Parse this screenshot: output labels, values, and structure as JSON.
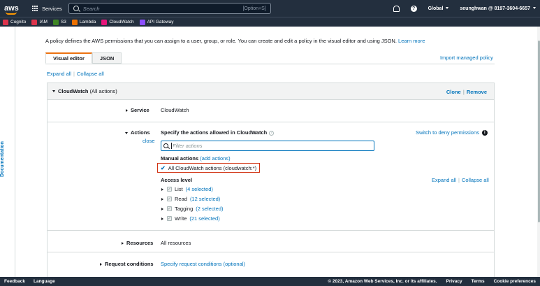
{
  "topnav": {
    "logo": "aws",
    "services_label": "Services",
    "search_placeholder": "Search",
    "search_shortcut": "[Option+S]",
    "region": "Global",
    "account": "seunghwan @ 8197-3604-6657"
  },
  "favorites": [
    {
      "label": "Cognito",
      "color": "#dd344c"
    },
    {
      "label": "IAM",
      "color": "#dd344c"
    },
    {
      "label": "S3",
      "color": "#3f8624"
    },
    {
      "label": "Lambda",
      "color": "#ed7100"
    },
    {
      "label": "CloudWatch",
      "color": "#e7157b"
    },
    {
      "label": "API Gateway",
      "color": "#8c4fff"
    }
  ],
  "sidebar": {
    "label": "Documentation"
  },
  "intro": {
    "text": "A policy defines the AWS permissions that you can assign to a user, group, or role. You can create and edit a policy in the visual editor and using JSON.",
    "learn_more": "Learn more"
  },
  "tabs": [
    {
      "label": "Visual editor",
      "active": true
    },
    {
      "label": "JSON",
      "active": false
    }
  ],
  "import_link": "Import managed policy",
  "expand_all": "Expand all",
  "collapse_all": "Collapse all",
  "panel": {
    "title": "CloudWatch",
    "title_suffix": "(All actions)",
    "clone": "Clone",
    "remove": "Remove",
    "service_label": "Service",
    "service_value": "CloudWatch",
    "actions_label": "Actions",
    "close_link": "close",
    "actions_heading": "Specify the actions allowed in CloudWatch",
    "switch_deny": "Switch to deny permissions",
    "filter_placeholder": "Filter actions",
    "manual_actions": "Manual actions",
    "add_actions": "(add actions)",
    "all_actions": "All CloudWatch actions (cloudwatch:*)",
    "access_level": "Access level",
    "expand_all": "Expand all",
    "collapse_all": "Collapse all",
    "access_levels": [
      {
        "name": "List",
        "count": "(4 selected)"
      },
      {
        "name": "Read",
        "count": "(12 selected)"
      },
      {
        "name": "Tagging",
        "count": "(2 selected)"
      },
      {
        "name": "Write",
        "count": "(21 selected)"
      }
    ],
    "resources_label": "Resources",
    "resources_value": "All resources",
    "request_conditions_label": "Request conditions",
    "request_conditions_value": "Specify request conditions (optional)"
  },
  "footer": {
    "feedback": "Feedback",
    "language": "Language",
    "copyright": "© 2023, Amazon Web Services, Inc. or its affiliates.",
    "privacy": "Privacy",
    "terms": "Terms",
    "cookie": "Cookie preferences"
  }
}
